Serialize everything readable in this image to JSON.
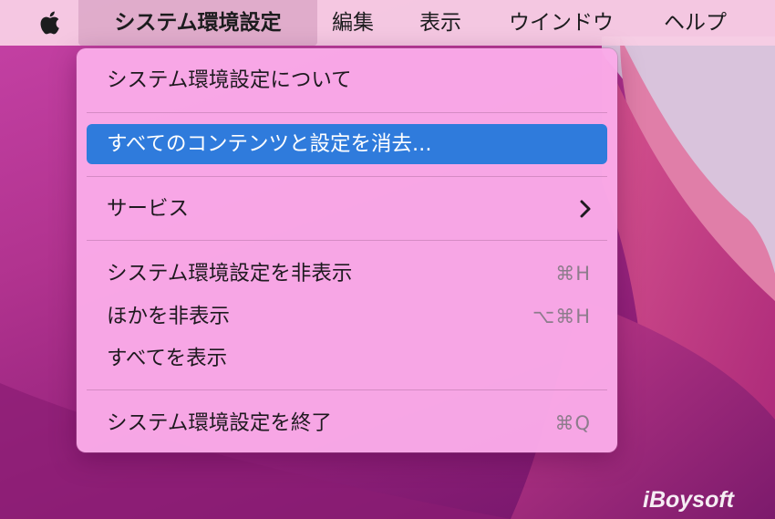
{
  "menubar": {
    "apple_icon": "apple-logo-icon",
    "app_menu": "システム環境設定",
    "menus": [
      "編集",
      "表示",
      "ウインドウ",
      "ヘルプ"
    ]
  },
  "dropdown": {
    "about": "システム環境設定について",
    "erase_all": "すべてのコンテンツと設定を消去...",
    "services": "サービス",
    "hide_app": "システム環境設定を非表示",
    "hide_app_shortcut": "⌘H",
    "hide_others": "ほかを非表示",
    "hide_others_shortcut": "⌥⌘H",
    "show_all": "すべてを表示",
    "quit": "システム環境設定を終了",
    "quit_shortcut": "⌘Q"
  },
  "watermark": {
    "text": "iBoysoft"
  },
  "colors": {
    "highlight": "#2f7bdc",
    "menu_bg": "#faaae8",
    "menubar_bg": "#f7cde4"
  }
}
